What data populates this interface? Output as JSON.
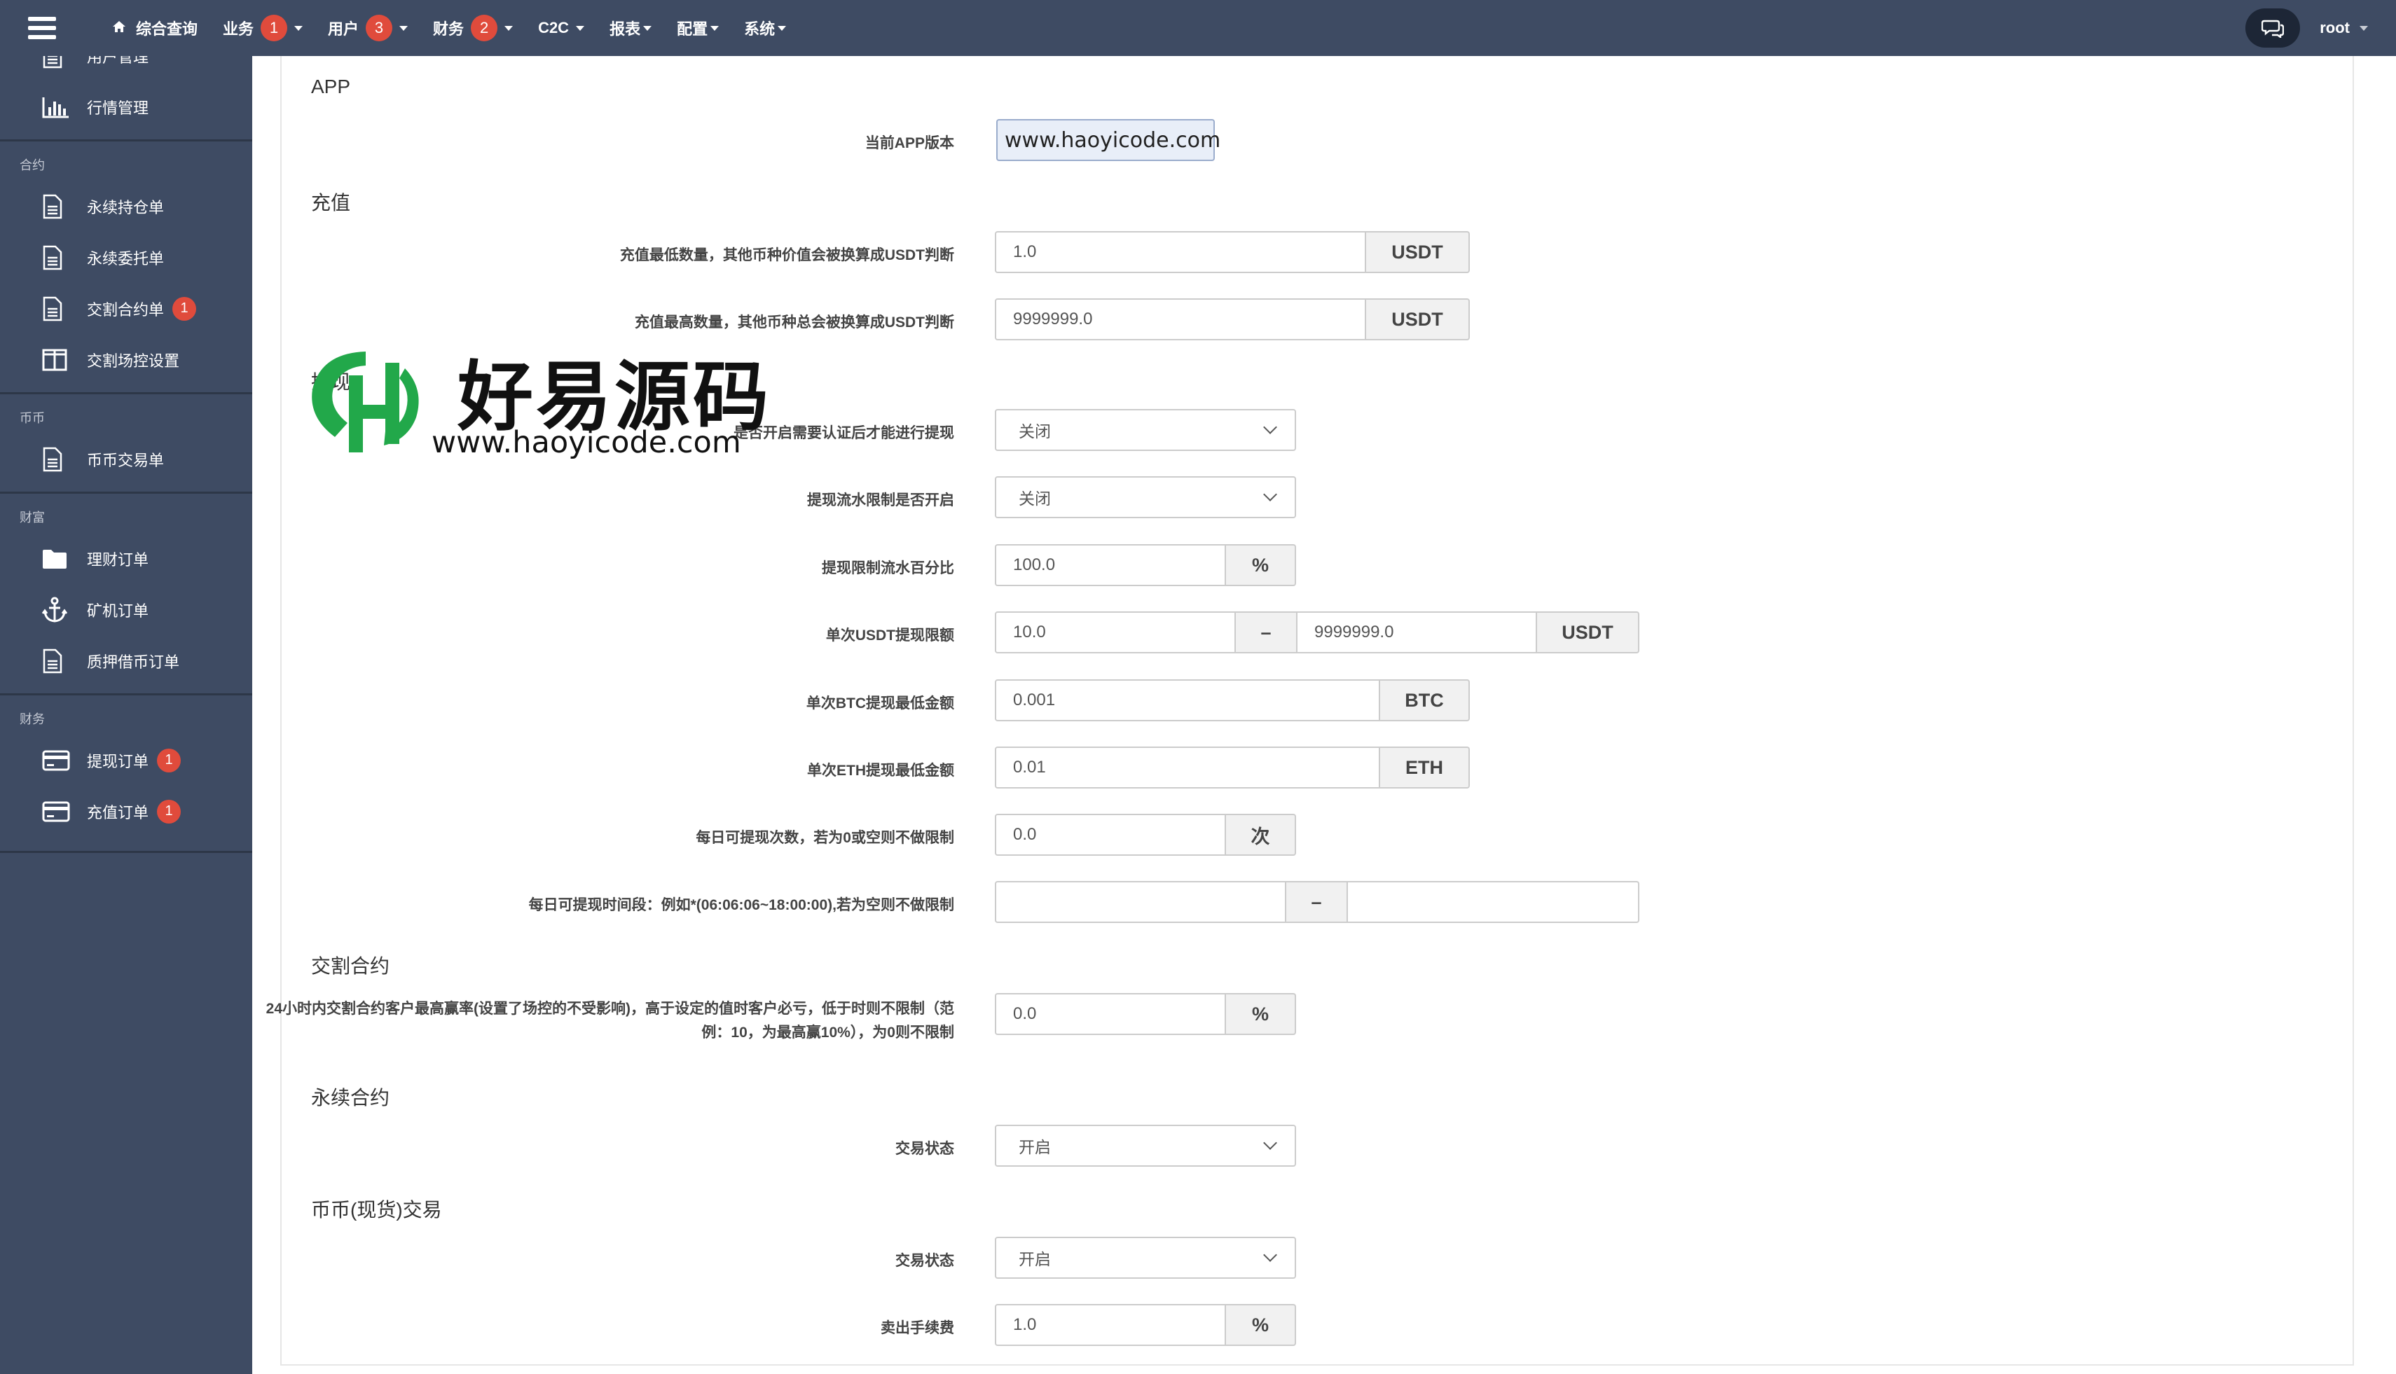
{
  "topnav": {
    "items": [
      {
        "label": "综合查询",
        "badge": null
      },
      {
        "label": "业务",
        "badge": "1"
      },
      {
        "label": "用户",
        "badge": "3"
      },
      {
        "label": "财务",
        "badge": "2"
      },
      {
        "label": "C2C",
        "badge": null
      },
      {
        "label": "报表",
        "badge": null
      },
      {
        "label": "配置",
        "badge": null
      },
      {
        "label": "系统",
        "badge": null
      }
    ],
    "user": "root"
  },
  "sidebar": {
    "cut_item": "用户管理",
    "market": "行情管理",
    "group_contract": "合约",
    "perpetual_positions": "永续持仓单",
    "perpetual_orders": "永续委托单",
    "delivery_orders": "交割合约单",
    "delivery_orders_badge": "1",
    "delivery_control": "交割场控设置",
    "group_coin": "币币",
    "coin_orders": "币币交易单",
    "group_wealth": "财富",
    "finance_orders": "理财订单",
    "miner_orders": "矿机订单",
    "pledge_orders": "质押借币订单",
    "group_finance": "财务",
    "withdraw_orders": "提现订单",
    "withdraw_badge": "1",
    "recharge_orders": "充值订单",
    "recharge_badge": "1"
  },
  "sections": {
    "app": "APP",
    "recharge": "充值",
    "withdraw": "提现",
    "delivery": "交割合约",
    "perpetual": "永续合约",
    "spot": "币币(现货)交易"
  },
  "fields": {
    "app_version_label": "当前APP版本",
    "app_version_value": "www.haoyicode.com",
    "recharge_min_label": "充值最低数量，其他币种价值会被换算成USDT判断",
    "recharge_min_value": "1.0",
    "recharge_min_unit": "USDT",
    "recharge_max_label": "充值最高数量，其他币种总会被换算成USDT判断",
    "recharge_max_value": "9999999.0",
    "recharge_max_unit": "USDT",
    "withdraw_kyc_label": "是否开启需要认证后才能进行提现",
    "withdraw_kyc_value": "关闭",
    "withdraw_flow_label": "提现流水限制是否开启",
    "withdraw_flow_value": "关闭",
    "withdraw_flow_pct_label": "提现限制流水百分比",
    "withdraw_flow_pct_value": "100.0",
    "withdraw_flow_pct_unit": "%",
    "usdt_limit_label": "单次USDT提现限额",
    "usdt_limit_min": "10.0",
    "usdt_limit_sep": "–",
    "usdt_limit_max": "9999999.0",
    "usdt_limit_unit": "USDT",
    "btc_min_label": "单次BTC提现最低金额",
    "btc_min_value": "0.001",
    "btc_min_unit": "BTC",
    "eth_min_label": "单次ETH提现最低金额",
    "eth_min_value": "0.01",
    "eth_min_unit": "ETH",
    "daily_count_label": "每日可提现次数，若为0或空则不做限制",
    "daily_count_value": "0.0",
    "daily_count_unit": "次",
    "daily_time_label": "每日可提现时间段：例如*(06:06:06~18:00:00),若为空则不做限制",
    "daily_time_start": "",
    "daily_time_sep": "–",
    "daily_time_end": "",
    "delivery_rate_label": "24小时内交割合约客户最高赢率(设置了场控的不受影响)，高于设定的值时客户必亏，低于时则不限制（范例：10，为最高赢10%），为0则不限制",
    "delivery_rate_value": "0.0",
    "delivery_rate_unit": "%",
    "perpetual_status_label": "交易状态",
    "perpetual_status_value": "开启",
    "spot_status_label": "交易状态",
    "spot_status_value": "开启",
    "spot_fee_label": "卖出手续费",
    "spot_fee_value": "1.0",
    "spot_fee_unit": "%"
  },
  "watermark": {
    "text": "好易源码",
    "url": "www.haoyicode.com"
  },
  "colors": {
    "sidebar_bg": "#3e4b63",
    "badge": "#e04b3c",
    "chat_btn": "#1d2636"
  }
}
